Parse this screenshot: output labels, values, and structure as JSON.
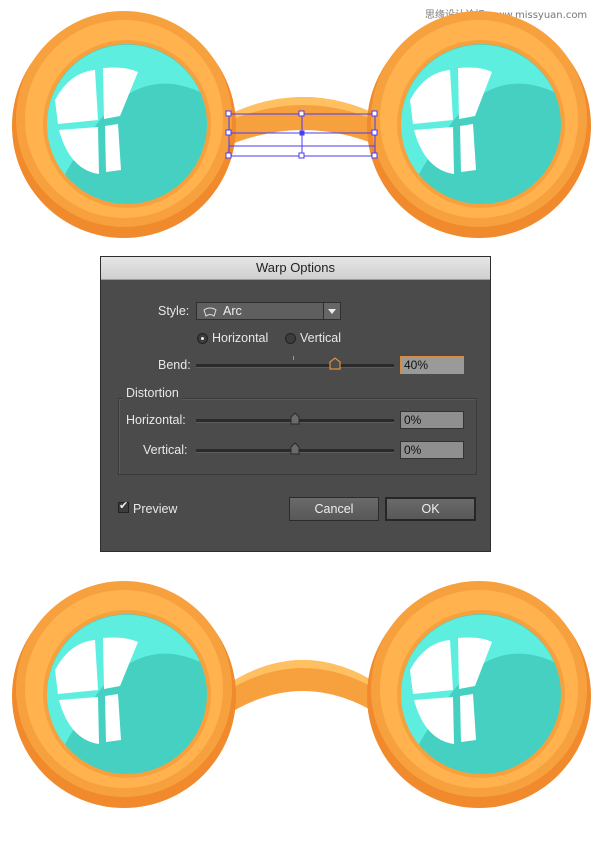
{
  "watermark": "思缘设计论坛 www.missyuan.com",
  "dialog": {
    "title": "Warp Options",
    "style_label": "Style:",
    "style_value": "Arc",
    "orientation": {
      "horizontal_label": "Horizontal",
      "vertical_label": "Vertical",
      "selected": "Horizontal"
    },
    "bend_label": "Bend:",
    "bend_value": "40%",
    "bend_fraction": 0.7,
    "distortion_title": "Distortion",
    "distortion_horizontal_label": "Horizontal:",
    "distortion_horizontal_value": "0%",
    "distortion_horizontal_fraction": 0.5,
    "distortion_vertical_label": "Vertical:",
    "distortion_vertical_value": "0%",
    "distortion_vertical_fraction": 0.5,
    "preview_label": "Preview",
    "preview_checked": true,
    "cancel_label": "Cancel",
    "ok_label": "OK"
  },
  "colors": {
    "frame_orange": "#f7a13e",
    "frame_dark": "#f08a2c",
    "frame_light": "#ffc062",
    "lens_light": "#5eeee0",
    "lens_dark": "#45d0c1",
    "glare": "#ffffff",
    "selection": "#4b3cf0"
  },
  "icons": {
    "style_icon": "arc-warp-icon",
    "check_icon": "checkmark-icon"
  }
}
